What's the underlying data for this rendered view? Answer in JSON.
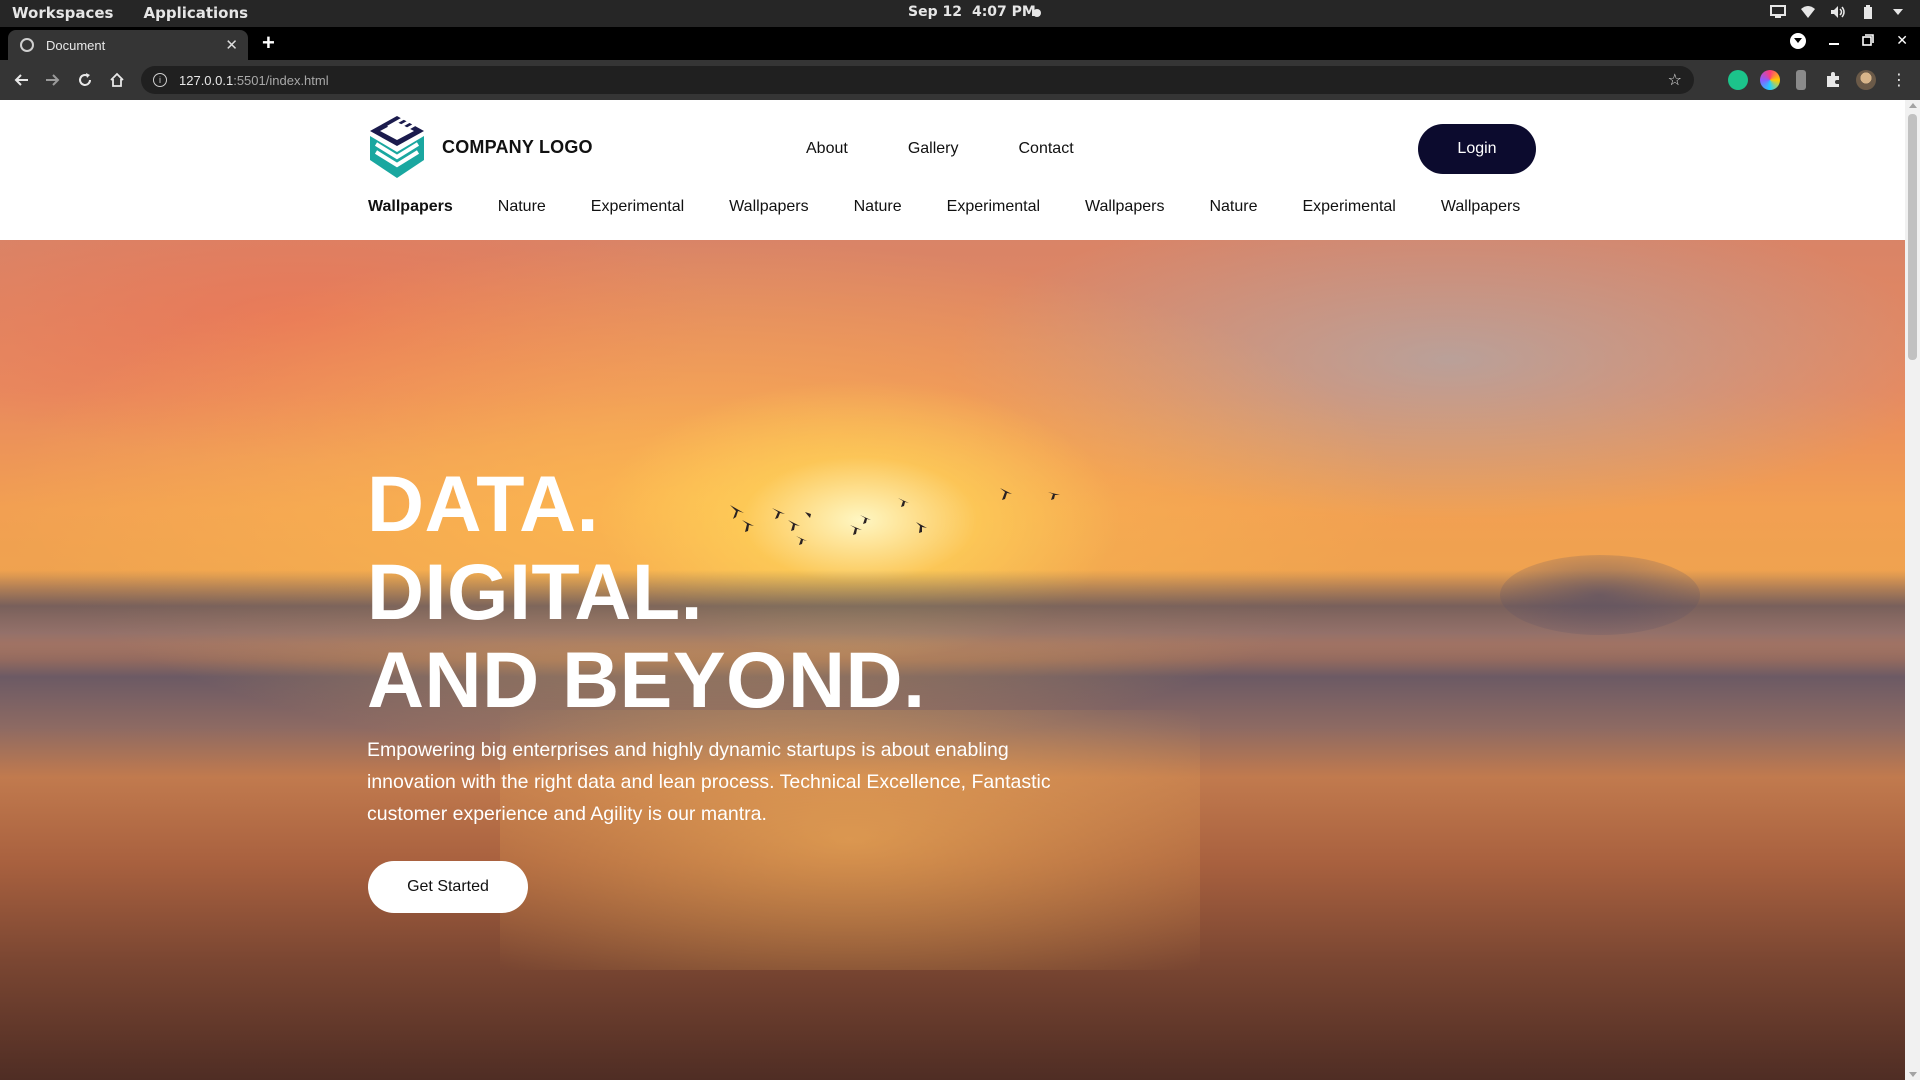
{
  "os": {
    "workspaces": "Workspaces",
    "applications": "Applications",
    "date": "Sep 12",
    "time": "4:07 PM"
  },
  "browser": {
    "tab_title": "Document",
    "url_host": "127.0.0.1",
    "url_path": ":5501/index.html"
  },
  "site": {
    "logo_text": "COMPANY LOGO",
    "brand_colors": {
      "logo_teal": "#1aa7a0",
      "logo_navy": "#1b1b4d",
      "login_bg": "#0c0b2e"
    },
    "topnav": [
      "About",
      "Gallery",
      "Contact"
    ],
    "login_label": "Login",
    "categories": [
      "Wallpapers",
      "Nature",
      "Experimental",
      "Wallpapers",
      "Nature",
      "Experimental",
      "Wallpapers",
      "Nature",
      "Experimental",
      "Wallpapers"
    ],
    "active_category_index": 0
  },
  "hero": {
    "line1": "DATA.",
    "line2": "DIGITAL.",
    "line3": "AND BEYOND.",
    "description": "Empowering big enterprises and highly dynamic startups is about enabling innovation with the right data and lean process. Technical Excellence, Fantastic customer experience and Agility is our mantra.",
    "cta_label": "Get Started"
  }
}
